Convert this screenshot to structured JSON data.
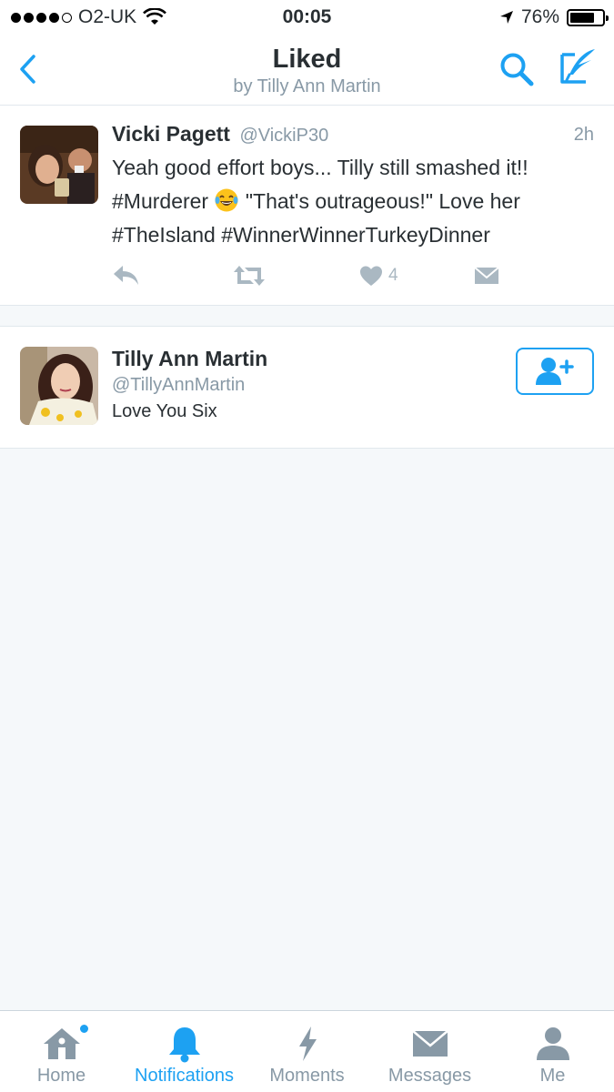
{
  "status_bar": {
    "carrier": "O2-UK",
    "time": "00:05",
    "battery": "76%",
    "battery_level": 0.76,
    "signal_bars_filled": 4,
    "signal_bars_total": 5
  },
  "nav": {
    "title": "Liked",
    "subtitle": "by Tilly Ann Martin",
    "accent_color": "#1da1f2"
  },
  "tweet": {
    "author_name": "Vicki Pagett",
    "author_handle": "@VickiP30",
    "time": "2h",
    "text_part1": "Yeah good effort boys... Tilly still smashed it!! #Murderer ",
    "emoji": "face-with-tears-of-joy",
    "text_part2": " \"That's outrageous!\" Love her #TheIsland #WinnerWinnerTurkeyDinner",
    "like_count": "4"
  },
  "user_card": {
    "name": "Tilly Ann Martin",
    "handle": "@TillyAnnMartin",
    "bio": "Love You Six"
  },
  "tabs": [
    {
      "label": "Home",
      "icon": "home-icon"
    },
    {
      "label": "Notifications",
      "icon": "bell-icon",
      "active": true
    },
    {
      "label": "Moments",
      "icon": "lightning-icon"
    },
    {
      "label": "Messages",
      "icon": "envelope-icon"
    },
    {
      "label": "Me",
      "icon": "person-icon"
    }
  ]
}
